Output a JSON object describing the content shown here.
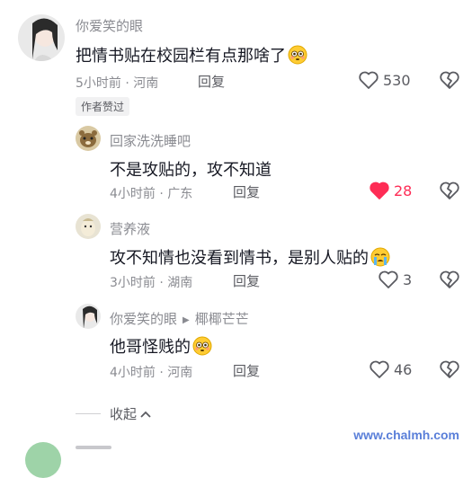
{
  "comments": [
    {
      "username": "你爱笑的眼",
      "text": "把情书贴在校园栏有点那啥了",
      "emoji": "flushed-emoji",
      "time": "5小时前",
      "location": "河南",
      "reply_label": "回复",
      "likes": "530",
      "liked": false,
      "badge": "作者赞过"
    },
    {
      "username": "回家洗洗睡吧",
      "text": "不是攻贴的，攻不知道",
      "time": "4小时前",
      "location": "广东",
      "reply_label": "回复",
      "likes": "28",
      "liked": true
    },
    {
      "username": "营养液",
      "text": "攻不知情也没看到情书，是别人贴的",
      "emoji": "crying-emoji",
      "time": "3小时前",
      "location": "湖南",
      "reply_label": "回复",
      "likes": "3",
      "liked": false
    },
    {
      "username": "你爱笑的眼",
      "reply_to": "椰椰芒芒",
      "text": "他哥怪贱的",
      "emoji": "flushed-emoji",
      "time": "4小时前",
      "location": "河南",
      "reply_label": "回复",
      "likes": "46",
      "liked": false
    }
  ],
  "collapse_label": "收起",
  "watermark": "www.chalmh.com",
  "colors": {
    "like_active": "#fe2c55",
    "muted": "#8a8b91",
    "text": "#161823"
  }
}
